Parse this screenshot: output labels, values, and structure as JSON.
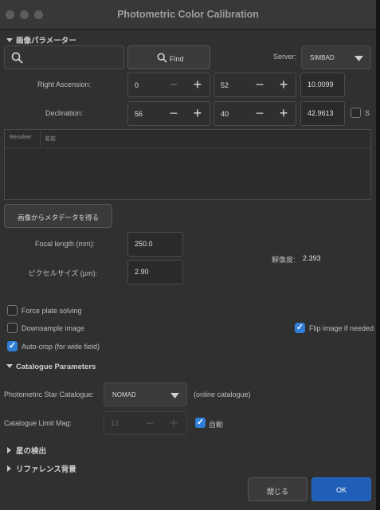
{
  "window": {
    "title": "Photometric Color Calibration"
  },
  "image_params": {
    "header": "画像パラメーター",
    "search_placeholder": "",
    "find_label": "Find",
    "server_label": "Server:",
    "server_value": "SIMBAD",
    "ra_label": "Right Ascension:",
    "ra_h": "0",
    "ra_m": "52",
    "ra_s": "10.0099",
    "dec_label": "Declination:",
    "dec_d": "56",
    "dec_m": "40",
    "dec_s": "42.9613",
    "south_label": "S",
    "table_cols": [
      "Resolver",
      "名前"
    ],
    "metadata_btn": "画像からメタデータを得る",
    "focal_label": "Focal length (mm):",
    "focal_value": "250.0",
    "pixel_label": "ピクセルサイズ (µm):",
    "pixel_value": "2.90",
    "resolution_label": "解像度:",
    "resolution_value": "2.393"
  },
  "options": {
    "force_plate": {
      "label": "Force plate solving",
      "checked": false
    },
    "downsample": {
      "label": "Downsample image",
      "checked": false
    },
    "autocrop": {
      "label": "Auto-crop (for wide field)",
      "checked": true
    },
    "flip": {
      "label": "Flip image if needed",
      "checked": true
    }
  },
  "catalogue": {
    "header": "Catalogue Parameters",
    "star_cat_label": "Photometric Star Catalogue:",
    "star_cat_value": "NOMAD",
    "online_note": "(online catalogue)",
    "limit_label": "Catalogue Limit Mag:",
    "limit_value": "12",
    "auto_label": "自動",
    "auto_checked": true
  },
  "sections": {
    "star_detect": "星の検出",
    "ref_background": "リファレンス背景"
  },
  "buttons": {
    "close": "閉じる",
    "ok": "OK"
  },
  "colors": {
    "accent": "#2f7fd6",
    "ok_button": "#1f5fb8",
    "panel": "#303030"
  },
  "icons": {
    "search": "search-icon",
    "find": "search-icon",
    "dropdown": "chevron-down-icon"
  }
}
